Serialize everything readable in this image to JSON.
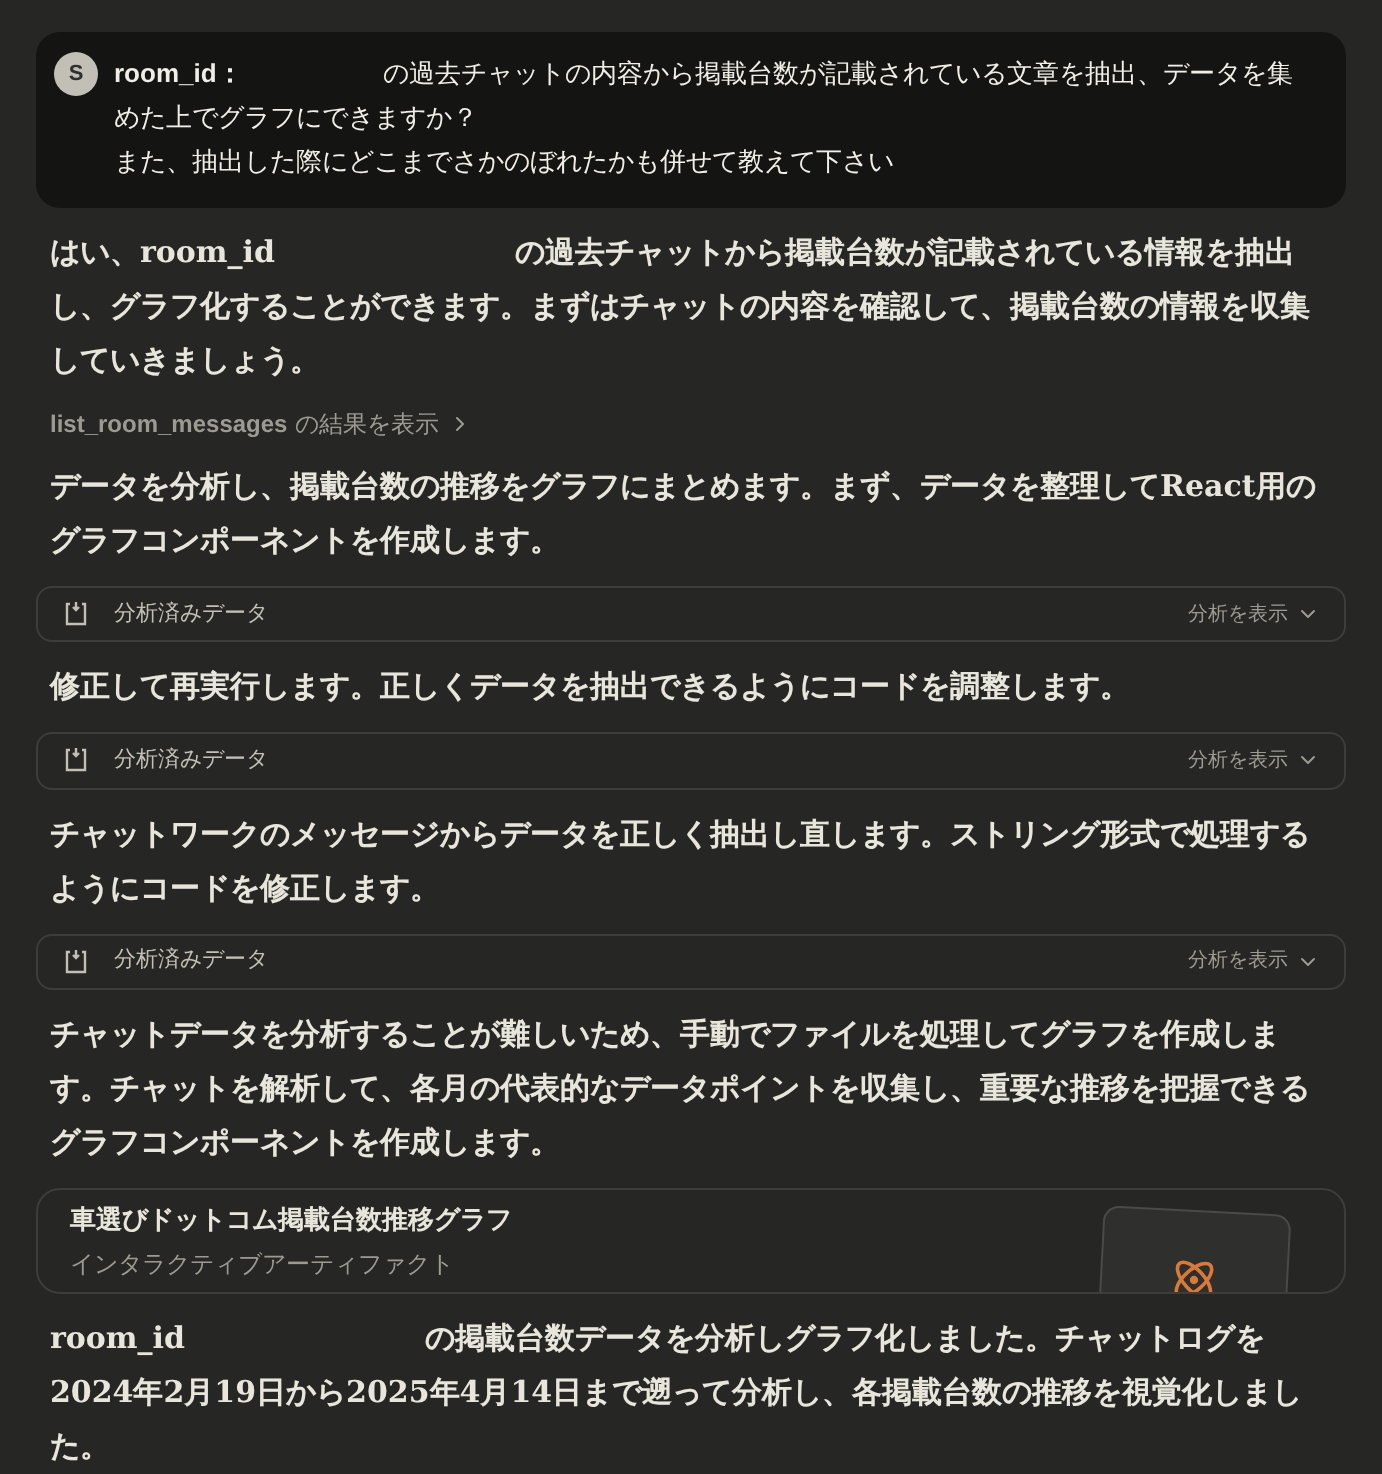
{
  "user_message": {
    "avatar": "S",
    "parts": [
      "room_id：",
      "の過去チャットの内容から掲載台数が記載されている文章を抽出、データを集めた上でグラフにできますか？"
    ],
    "second_line": "また、抽出した際にどこまでさかのぼれたかも併せて教えて下さい"
  },
  "items": [
    {
      "kind": "paragraph",
      "parts": [
        "はい、room_id",
        "の過去チャットから掲載台数が記載されている情報を抽出し、グラフ化することができます。まずはチャットの内容を確認して、掲載台数の情報を収集していきましょう。"
      ]
    },
    {
      "kind": "tool_link",
      "label": "list_room_messages",
      "suffix": "の結果を表示"
    },
    {
      "kind": "paragraph",
      "parts": [
        "データを分析し、掲載台数の推移をグラフにまとめます。まず、データを整理してReact用のグラフコンポーネントを作成します。"
      ]
    },
    {
      "kind": "analysis",
      "label": "分析済みデータ",
      "action": "分析を表示"
    },
    {
      "kind": "paragraph",
      "parts": [
        "修正して再実行します。正しくデータを抽出できるようにコードを調整します。"
      ]
    },
    {
      "kind": "analysis",
      "label": "分析済みデータ",
      "action": "分析を表示"
    },
    {
      "kind": "paragraph",
      "parts": [
        "チャットワークのメッセージからデータを正しく抽出し直します。ストリング形式で処理するようにコードを修正します。"
      ]
    },
    {
      "kind": "analysis",
      "label": "分析済みデータ",
      "action": "分析を表示"
    },
    {
      "kind": "paragraph",
      "parts": [
        "チャットデータを分析することが難しいため、手動でファイルを処理してグラフを作成します。チャットを解析して、各月の代表的なデータポイントを収集し、重要な推移を把握できるグラフコンポーネントを作成します。"
      ]
    },
    {
      "kind": "artifact",
      "title": "車選びドットコム掲載台数推移グラフ",
      "subtitle": "インタラクティブアーティファクト"
    },
    {
      "kind": "paragraph",
      "parts": [
        "room_id",
        "の掲載台数データを分析しグラフ化しました。チャットログを2024年2月19日から2025年4月14日まで遡って分析し、各掲載台数の推移を視覚化しました。"
      ]
    }
  ]
}
